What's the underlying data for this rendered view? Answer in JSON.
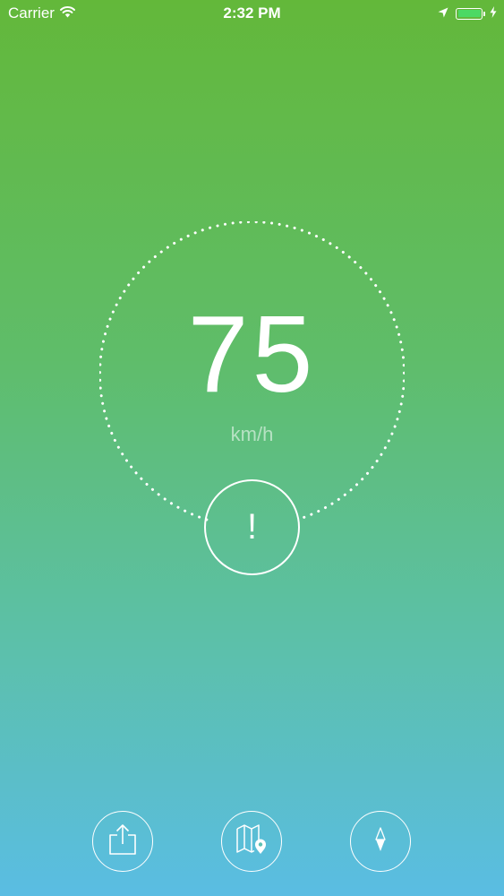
{
  "status_bar": {
    "carrier": "Carrier",
    "time": "2:32 PM",
    "battery_level": 1.0,
    "battery_color": "#4cd964"
  },
  "speedometer": {
    "speed": "75",
    "unit": "km/h",
    "alert_label": "!"
  },
  "toolbar": {
    "items": [
      {
        "icon": "share-icon"
      },
      {
        "icon": "map-location-icon"
      },
      {
        "icon": "compass-icon"
      }
    ]
  },
  "colors": {
    "gradient_top": "#63b83a",
    "gradient_bottom": "#5abde3",
    "foreground": "#ffffff"
  }
}
